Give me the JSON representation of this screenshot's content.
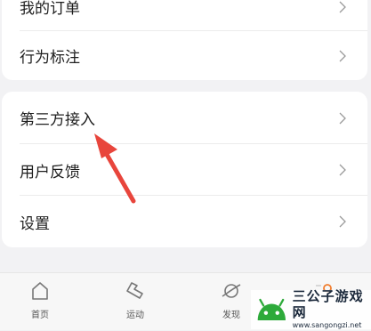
{
  "card_top": {
    "items": [
      {
        "label": "我的订单"
      },
      {
        "label": "行为标注"
      }
    ]
  },
  "card_main": {
    "items": [
      {
        "label": "第三方接入"
      },
      {
        "label": "用户反馈"
      },
      {
        "label": "设置"
      }
    ]
  },
  "tabbar": {
    "tabs": [
      {
        "label": "首页",
        "icon": "home-icon"
      },
      {
        "label": "运动",
        "icon": "shoe-icon"
      },
      {
        "label": "发现",
        "icon": "planet-icon"
      },
      {
        "label": "",
        "icon": "profile-icon"
      }
    ]
  },
  "watermark": {
    "title": "三公子游戏网",
    "url": "www.sangongzi.net"
  },
  "colors": {
    "accent_red": "#e8453c",
    "watermark_green": "#2daa3a"
  }
}
